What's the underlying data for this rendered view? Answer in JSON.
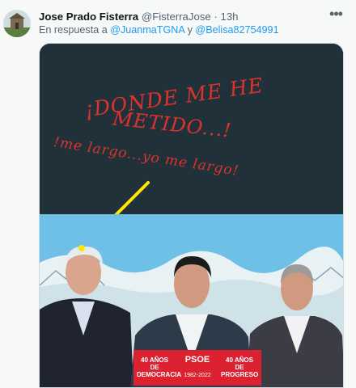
{
  "tweet": {
    "author_name": "Jose Prado Fisterra",
    "author_handle": "@FisterraJose",
    "separator": "·",
    "time": "13h",
    "reply_prefix": "En respuesta a",
    "reply_conjunction": "y",
    "mentions": [
      "@JuanmaTGNA",
      "@Belisa82754991"
    ],
    "more_icon": "more-horizontal-icon"
  },
  "meme": {
    "line1": "¡DONDE ME HE",
    "line2": "METIDO...!",
    "line3": "!me largo...yo me largo!"
  },
  "banner": {
    "left_top": "40 AÑOS DE",
    "left_bottom": "DEMOCRACIA",
    "center": "PSOE",
    "right_top": "40 AÑOS DE",
    "right_bottom": "PROGRESO",
    "years": "1982-2022"
  },
  "colors": {
    "accent": "#1d9bf0",
    "meme_text": "#e0322c",
    "banner": "#dc2130"
  }
}
